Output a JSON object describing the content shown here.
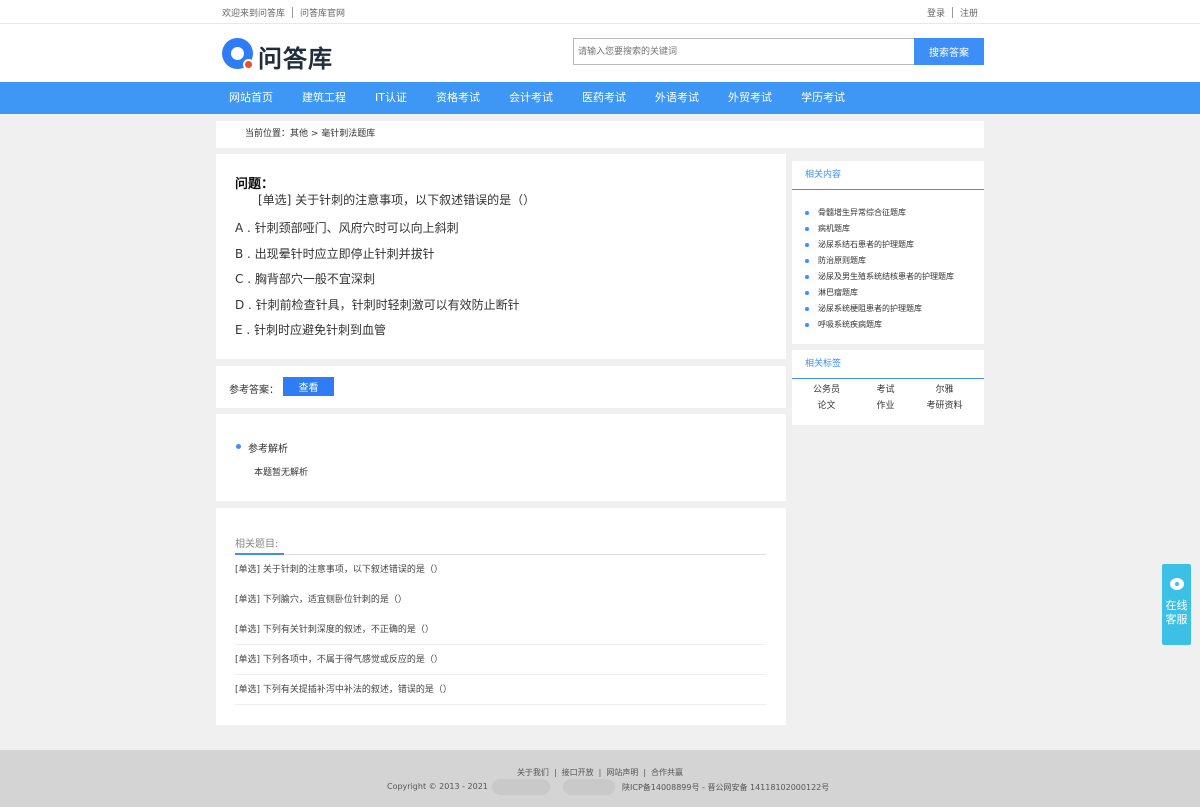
{
  "topbar": {
    "welcome": "欢迎来到问答库",
    "official": "问答库官网",
    "login": "登录",
    "register": "注册"
  },
  "header": {
    "logo_text": "问答库",
    "search_placeholder": "请输入您要搜索的关键词",
    "search_button": "搜索答案"
  },
  "nav": [
    "网站首页",
    "建筑工程",
    "IT认证",
    "资格考试",
    "会计考试",
    "医药考试",
    "外语考试",
    "外贸考试",
    "学历考试"
  ],
  "breadcrumb": "当前位置：其他 > 毫针刺法题库",
  "question": {
    "title": "问题：",
    "stem": "[单选] 关于针刺的注意事项，以下叙述错误的是（）",
    "options": [
      "A . 针刺颈部哑门、风府穴时可以向上斜刺",
      "B . 出现晕针时应立即停止针刺并拔针",
      "C . 胸背部穴一般不宜深刺",
      "D . 针刺前检查针具，针刺时轻刺激可以有效防止断针",
      "E . 针刺时应避免针刺到血管"
    ]
  },
  "answer": {
    "label": "参考答案：",
    "button": "查看"
  },
  "analysis": {
    "heading": "参考解析",
    "body": "本题暂无解析"
  },
  "related": {
    "title": "相关题目:",
    "items": [
      "[单选] 关于针刺的注意事项，以下叙述错误的是（）",
      "[单选] 下列腧穴，适宜侧卧位针刺的是（）",
      "[单选] 下列有关针刺深度的叙述，不正确的是（）",
      "[单选] 下列各项中，不属于得气感觉或反应的是（）",
      "[单选] 下列有关提插补泻中补法的叙述，错误的是（）"
    ]
  },
  "sidebar": {
    "related_title": "相关内容",
    "related_items": [
      "骨髓增生异常综合征题库",
      "病机题库",
      "泌尿系结石患者的护理题库",
      "防治原则题库",
      "泌尿及男生殖系统结核患者的护理题库",
      "淋巴瘤题库",
      "泌尿系统梗阻患者的护理题库",
      "呼吸系统疾病题库"
    ],
    "tags_title": "相关标签",
    "tags": [
      "公务员",
      "考试",
      "尔雅",
      "论文",
      "作业",
      "考研资料"
    ]
  },
  "chat": {
    "line1": "在线",
    "line2": "客服"
  },
  "footer": {
    "links": [
      "关于我们",
      "接口开放",
      "网站声明",
      "合作共赢"
    ],
    "copyright": "Copyright © 2013 - 2021",
    "icp": "陕ICP备14008899号 - 晋公网安备 14118102000122号"
  },
  "colors": {
    "accent": "#3e97f5",
    "chat": "#3dc0e6",
    "logo_red": "#e94b3c"
  }
}
